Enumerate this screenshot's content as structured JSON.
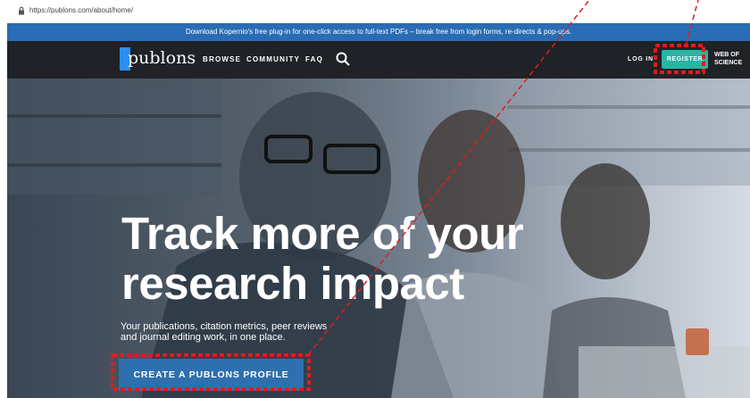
{
  "browser": {
    "url": "https://publons.com/about/home/"
  },
  "banner": {
    "text": "Download Kopernio's free plug-in for one-click access to full-text PDFs – break free from login forms, re-directs & pop-ups."
  },
  "nav": {
    "logo": "publons",
    "links": [
      "BROWSE",
      "COMMUNITY",
      "FAQ"
    ],
    "login_label": "LOG IN",
    "register_label": "REGISTER",
    "wos_label_line1": "WEB OF",
    "wos_label_line2": "SCIENCE"
  },
  "hero": {
    "title_line1": "Track more of your",
    "title_line2": "research impact",
    "subtitle_line1": "Your publications, citation metrics, peer reviews",
    "subtitle_line2": "and journal editing work, in one place.",
    "cta_label": "CREATE A PUBLONS PROFILE"
  },
  "colors": {
    "banner": "#2a6cb3",
    "nav": "#1f2226",
    "register": "#27b5a4",
    "cta": "#2e6fb0",
    "annotation": "#e21b1b"
  }
}
